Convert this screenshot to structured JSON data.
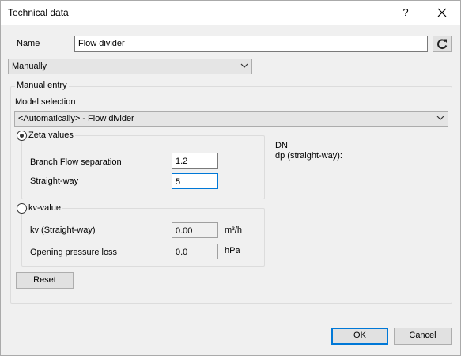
{
  "window": {
    "title": "Technical data",
    "help_label": "?"
  },
  "name_field": {
    "label": "Name",
    "value": "Flow divider"
  },
  "mode_select": {
    "value": "Manually"
  },
  "manual_entry": {
    "title": "Manual entry",
    "model_selection_label": "Model selection",
    "model_selection_value": "<Automatically> - Flow divider"
  },
  "zeta": {
    "label": "Zeta values",
    "selected": true,
    "branch_label": "Branch Flow separation",
    "branch_value": "1.2",
    "straight_label": "Straight-way",
    "straight_value": "5"
  },
  "kv": {
    "label": "kv-value",
    "selected": false,
    "kv_label": "kv (Straight-way)",
    "kv_value": "0.00",
    "kv_unit": "m³/h",
    "pressure_label": "Opening pressure loss",
    "pressure_value": "0.0",
    "pressure_unit": "hPa"
  },
  "info": {
    "dn_label": "DN",
    "dp_label": "dp (straight-way):"
  },
  "buttons": {
    "reset": "Reset",
    "ok": "OK",
    "cancel": "Cancel"
  },
  "icons": {
    "refresh": "refresh-icon",
    "close": "close-icon",
    "dropdown": "chevron-down-icon"
  }
}
